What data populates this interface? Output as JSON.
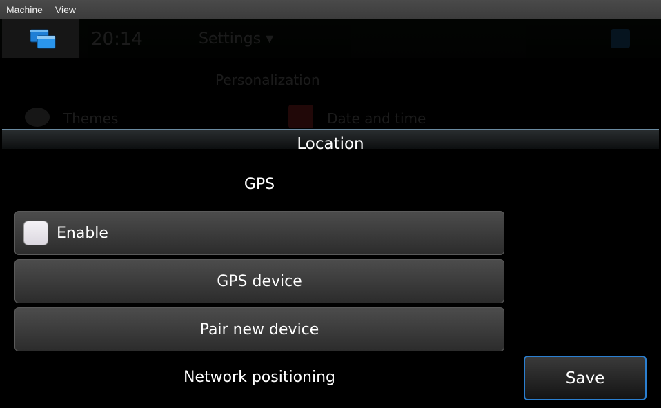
{
  "menubar": {
    "items": [
      {
        "label": "Machine"
      },
      {
        "label": "View"
      }
    ]
  },
  "background": {
    "clock": "20:14",
    "menu_title": "Settings ▾",
    "section": "Personalization",
    "items": [
      {
        "label": "Themes"
      },
      {
        "label": "Date and time"
      }
    ]
  },
  "dialog": {
    "title": "Location",
    "gps_section": "GPS",
    "enable_label": "Enable",
    "enable_checked": false,
    "gps_device_label": "GPS device",
    "pair_label": "Pair new device",
    "network_section": "Network positioning",
    "save_label": "Save"
  },
  "colors": {
    "accent": "#2b7fd0",
    "header_border": "#6a8aa0"
  }
}
